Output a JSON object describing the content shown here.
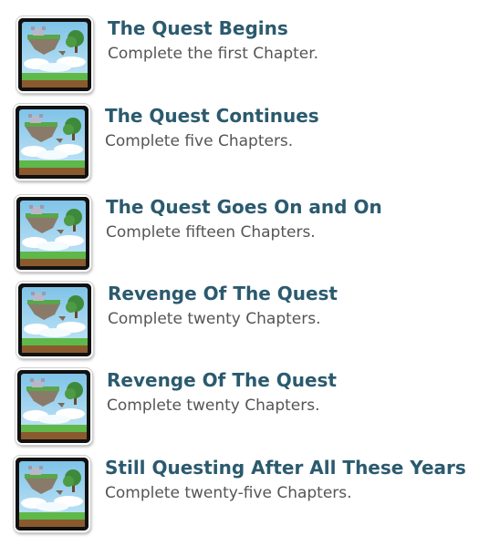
{
  "thumbnail_icon": "floating-island-icon",
  "colors": {
    "title": "#2b5a6e",
    "description": "#555555"
  },
  "achievements": [
    {
      "title": "The Quest Begins",
      "description": "Complete the first Chapter."
    },
    {
      "title": "The Quest Continues",
      "description": "Complete five Chapters."
    },
    {
      "title": "The Quest Goes On and On",
      "description": "Complete fifteen Chapters."
    },
    {
      "title": "Revenge Of The Quest",
      "description": "Complete twenty Chapters."
    },
    {
      "title": "Revenge Of The Quest",
      "description": "Complete twenty Chapters."
    },
    {
      "title": "Still Questing After All These Years",
      "description": "Complete twenty-five Chapters."
    }
  ]
}
